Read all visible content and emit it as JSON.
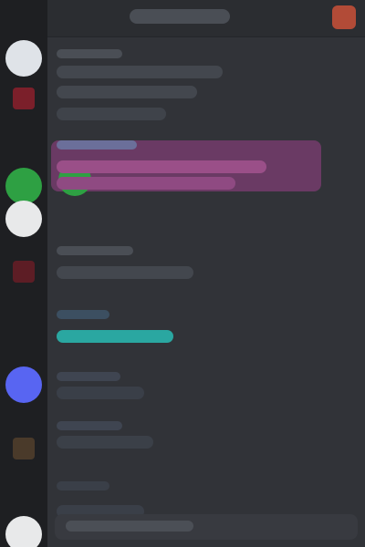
{
  "app": {
    "title": "",
    "badge": ""
  },
  "channel": {
    "name": ""
  },
  "messages": [
    {
      "author": "",
      "text": ""
    },
    {
      "author": "",
      "text": ""
    },
    {
      "author": "",
      "text": ""
    },
    {
      "author": "",
      "text": ""
    },
    {
      "author": "",
      "text": ""
    },
    {
      "author": "",
      "text": ""
    },
    {
      "author": "",
      "text": ""
    }
  ],
  "composer": {
    "placeholder": ""
  },
  "colors": {
    "rail": "#1e1f22",
    "sidebar": "#2b2d31",
    "main": "#313338",
    "highlight": "#6a3a64",
    "badge": "#b24b37",
    "online": "#2ea043",
    "accent_blue": "#5865f2",
    "accent_teal": "#2aa7a1"
  }
}
